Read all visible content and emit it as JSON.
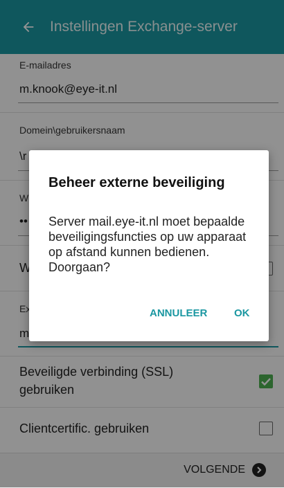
{
  "appbar": {
    "title": "Instellingen Exchange-server",
    "back_icon": "arrow-left-icon",
    "bg": "#1a97a1"
  },
  "form": {
    "email_label": "E-mailadres",
    "email_value": "m.knook@eye-it.nl",
    "domain_label": "Domein\\gebruikersnaam",
    "domain_value": "\\r",
    "password_label": "W",
    "password_value": "••",
    "row3_label": "W",
    "exchange_label": "Ex",
    "exchange_value": "m",
    "ssl_label": "Beveiligde verbinding (SSL) gebruiken",
    "ssl_checked": true,
    "clientcert_label": "Clientcertific. gebruiken",
    "clientcert_checked": false
  },
  "bottom": {
    "next_label": "VOLGENDE",
    "next_icon": "chevron-right-circle-icon"
  },
  "dialog": {
    "title": "Beheer externe beveiliging",
    "body": "Server mail.eye-it.nl moet bepaalde beveiligingsfuncties op uw apparaat op afstand kunnen bedienen. Doorgaan?",
    "cancel_label": "ANNULEER",
    "ok_label": "OK",
    "accent": "#1a97a1"
  },
  "colors": {
    "check_green": "#4caf50"
  }
}
